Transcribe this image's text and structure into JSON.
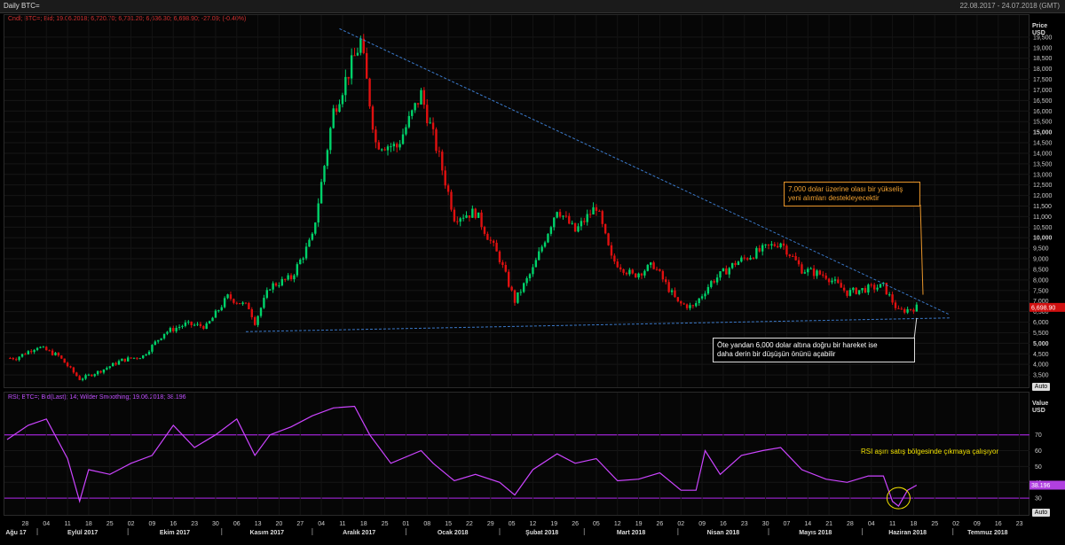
{
  "window": {
    "title": "Daily BTC=",
    "date_range": "22.08.2017 - 24.07.2018 (GMT)"
  },
  "price_panel": {
    "header": "Cndl; BTC=; Bid; 19.06.2018; 6,720.70; 6,731.20; 6,636.30; 6,698.90; -27.09; (-0.40%)",
    "axis_title": [
      "Price",
      "USD"
    ],
    "ticks": [
      "3,500",
      "4,000",
      "4,500",
      "5,000",
      "5,500",
      "6,000",
      "6,500",
      "7,000",
      "7,500",
      "8,000",
      "8,500",
      "9,000",
      "9,500",
      "10,000",
      "10,500",
      "11,000",
      "11,500",
      "12,000",
      "12,500",
      "13,000",
      "13,500",
      "14,000",
      "14,500",
      "15,000",
      "15,500",
      "16,000",
      "16,500",
      "17,000",
      "17,500",
      "18,000",
      "18,500",
      "19,000",
      "19,500"
    ],
    "last_value": "6,698.90",
    "auto_label": "Auto"
  },
  "rsi_panel": {
    "header": "RSI; BTC=; Bid(Last); 14; Wilder Smoothing; 19.06.2018; 38.196",
    "axis_title": [
      "Value",
      "USD"
    ],
    "ticks": [
      "30",
      "40",
      "50",
      "60",
      "70"
    ],
    "last_value": "38.196",
    "auto_label": "Auto"
  },
  "annotations": {
    "top": [
      "7,000 dolar üzerine olası bir yükseliş",
      "yeni alımları destekleyecektir"
    ],
    "bottom": [
      "Öte yandan 6,000 dolar altına doğru bir hareket ise",
      "daha derin bir düşüşün önünü açabilir"
    ],
    "rsi": "RSI aşırı satış bölgesinde çıkmaya çalışıyor"
  },
  "x_axis": {
    "day_ticks": [
      "28",
      "04",
      "11",
      "18",
      "25",
      "02",
      "09",
      "16",
      "23",
      "30",
      "06",
      "13",
      "20",
      "27",
      "04",
      "11",
      "18",
      "25",
      "01",
      "08",
      "15",
      "22",
      "29",
      "05",
      "12",
      "19",
      "26",
      "05",
      "12",
      "19",
      "26",
      "02",
      "09",
      "16",
      "23",
      "30",
      "07",
      "14",
      "21",
      "28",
      "04",
      "11",
      "18",
      "25",
      "02",
      "09",
      "16",
      "23"
    ],
    "month_labels": [
      "Ağu 17",
      "Eylül 2017",
      "Ekim 2017",
      "Kasım 2017",
      "Aralık 2017",
      "Ocak 2018",
      "Şubat 2018",
      "Mart 2018",
      "Nisan 2018",
      "Mayıs 2018",
      "Haziran 2018",
      "Temmuz 2018"
    ]
  },
  "colors": {
    "up": "#00d26a",
    "down": "#e01010",
    "rsi": "#cc44ff",
    "trend": "#3a78c8",
    "level": "#9020c0"
  },
  "chart_data": [
    {
      "type": "candlestick",
      "title": "",
      "ylabel": "Price USD",
      "ylim": [
        3000,
        20000
      ],
      "x_range": [
        "2017-08-22",
        "2018-07-24"
      ],
      "points": [
        [
          "2017-08-25",
          4300
        ],
        [
          "2017-09-01",
          4850
        ],
        [
          "2017-09-08",
          4400
        ],
        [
          "2017-09-15",
          3300
        ],
        [
          "2017-09-22",
          3700
        ],
        [
          "2017-09-29",
          4200
        ],
        [
          "2017-10-06",
          4400
        ],
        [
          "2017-10-13",
          5500
        ],
        [
          "2017-10-20",
          5900
        ],
        [
          "2017-10-27",
          5800
        ],
        [
          "2017-11-03",
          7200
        ],
        [
          "2017-11-10",
          6700
        ],
        [
          "2017-11-12",
          6000
        ],
        [
          "2017-11-17",
          7700
        ],
        [
          "2017-11-24",
          8100
        ],
        [
          "2017-12-01",
          10000
        ],
        [
          "2017-12-08",
          16000
        ],
        [
          "2017-12-17",
          19300
        ],
        [
          "2017-12-22",
          14500
        ],
        [
          "2017-12-29",
          14300
        ],
        [
          "2018-01-06",
          16800
        ],
        [
          "2018-01-12",
          13800
        ],
        [
          "2018-01-17",
          11000
        ],
        [
          "2018-01-24",
          11200
        ],
        [
          "2018-02-01",
          9000
        ],
        [
          "2018-02-06",
          7000
        ],
        [
          "2018-02-12",
          8500
        ],
        [
          "2018-02-20",
          11400
        ],
        [
          "2018-02-26",
          10300
        ],
        [
          "2018-03-05",
          11500
        ],
        [
          "2018-03-10",
          9000
        ],
        [
          "2018-03-17",
          8200
        ],
        [
          "2018-03-24",
          8700
        ],
        [
          "2018-04-01",
          6900
        ],
        [
          "2018-04-06",
          6700
        ],
        [
          "2018-04-12",
          7900
        ],
        [
          "2018-04-20",
          8800
        ],
        [
          "2018-04-27",
          9300
        ],
        [
          "2018-05-05",
          9800
        ],
        [
          "2018-05-12",
          8500
        ],
        [
          "2018-05-20",
          8200
        ],
        [
          "2018-05-27",
          7400
        ],
        [
          "2018-06-03",
          7600
        ],
        [
          "2018-06-08",
          7700
        ],
        [
          "2018-06-13",
          6500
        ],
        [
          "2018-06-19",
          6699
        ]
      ],
      "trendlines": [
        {
          "kind": "descending",
          "from": [
            "2017-12-10",
            19900
          ],
          "to": [
            "2018-06-30",
            6350
          ]
        },
        {
          "kind": "support",
          "from": [
            "2017-11-09",
            5550
          ],
          "to": [
            "2018-06-30",
            6200
          ]
        }
      ],
      "last": 6698.9
    },
    {
      "type": "line",
      "title": "",
      "ylabel": "Value USD",
      "ylim": [
        20,
        95
      ],
      "levels": [
        30,
        70
      ],
      "points": [
        [
          "2017-08-22",
          67
        ],
        [
          "2017-08-29",
          76
        ],
        [
          "2017-09-04",
          80
        ],
        [
          "2017-09-11",
          55
        ],
        [
          "2017-09-15",
          28
        ],
        [
          "2017-09-18",
          48
        ],
        [
          "2017-09-25",
          45
        ],
        [
          "2017-10-02",
          52
        ],
        [
          "2017-10-09",
          57
        ],
        [
          "2017-10-16",
          76
        ],
        [
          "2017-10-23",
          62
        ],
        [
          "2017-10-30",
          70
        ],
        [
          "2017-11-06",
          80
        ],
        [
          "2017-11-12",
          57
        ],
        [
          "2017-11-17",
          70
        ],
        [
          "2017-11-24",
          75
        ],
        [
          "2017-12-01",
          82
        ],
        [
          "2017-12-08",
          87
        ],
        [
          "2017-12-15",
          88
        ],
        [
          "2017-12-20",
          70
        ],
        [
          "2017-12-27",
          52
        ],
        [
          "2018-01-06",
          60
        ],
        [
          "2018-01-10",
          52
        ],
        [
          "2018-01-17",
          41
        ],
        [
          "2018-01-24",
          45
        ],
        [
          "2018-02-01",
          40
        ],
        [
          "2018-02-06",
          32
        ],
        [
          "2018-02-12",
          48
        ],
        [
          "2018-02-20",
          58
        ],
        [
          "2018-02-26",
          52
        ],
        [
          "2018-03-05",
          55
        ],
        [
          "2018-03-12",
          41
        ],
        [
          "2018-03-19",
          42
        ],
        [
          "2018-03-26",
          46
        ],
        [
          "2018-04-02",
          35
        ],
        [
          "2018-04-07",
          35
        ],
        [
          "2018-04-10",
          60
        ],
        [
          "2018-04-15",
          45
        ],
        [
          "2018-04-22",
          57
        ],
        [
          "2018-04-29",
          60
        ],
        [
          "2018-05-05",
          62
        ],
        [
          "2018-05-12",
          48
        ],
        [
          "2018-05-20",
          42
        ],
        [
          "2018-05-27",
          40
        ],
        [
          "2018-06-03",
          44
        ],
        [
          "2018-06-08",
          44
        ],
        [
          "2018-06-11",
          28
        ],
        [
          "2018-06-13",
          25
        ],
        [
          "2018-06-16",
          35
        ],
        [
          "2018-06-19",
          38.196
        ]
      ],
      "last": 38.196
    }
  ]
}
